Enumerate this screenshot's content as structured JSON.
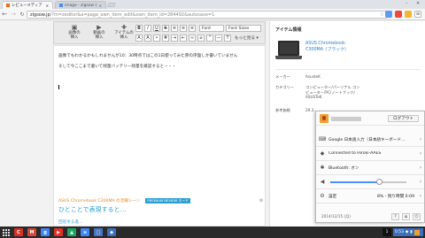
{
  "browser": {
    "tabs": [
      {
        "title": "レビューメディア「ジ…",
        "active": true
      },
      {
        "title": "image - zigsow (ジグ…",
        "active": false
      }
    ],
    "url_host": "zigsow.jp",
    "url_path": "/?m=zeditor&a=page_own_item_edit&own_item_id=284492&autosave=1"
  },
  "editor": {
    "insert_buttons": [
      {
        "label": "画像の\n挿入",
        "icon": "image-insert-icon"
      },
      {
        "label": "動画の\n挿入",
        "icon": "video-insert-icon"
      },
      {
        "label": "アイテムの\n挿入",
        "icon": "item-insert-icon"
      }
    ],
    "format": {
      "bold": "B",
      "italic": "I",
      "underline": "U",
      "strike": "S",
      "font": "Font",
      "font_sizes": "Font Sizes",
      "more": "もっと見る"
    },
    "paragraphs": [
      "画像でもわかるかもしれませんが10：30時点ではこの1日使ってみた際の序盤しか書いていません",
      "そして今ここまで書いて残量バッテリー残量を確認すると・・・"
    ],
    "footer": {
      "link": "ASUS Chromebook C300MA の活躍シーン",
      "badge": "PREMIUM REVIEW モード",
      "title": "ひとことで表現すると…",
      "subtitle": "回答する進..."
    }
  },
  "item_panel": {
    "heading": "アイテム情報",
    "product": "ASUS Chromebook\nC300MA（ブラック）",
    "specs": [
      {
        "label": "メーカー",
        "value": "AsusteK"
      },
      {
        "label": "カテゴリー",
        "value": "コンピューター/パーソナル コン\nピューター/PC/ノートブック/\nASUSTeK"
      },
      {
        "label": "参考価格",
        "value": "29,3…"
      }
    ]
  },
  "tray": {
    "logout": "ログアウト",
    "rows": [
      {
        "icon": "keyboard-icon",
        "label": "Google 日本語入力（日本語キーボード…"
      },
      {
        "icon": "wifi-icon",
        "label": "Connected to Hiroki-AAES"
      },
      {
        "icon": "bluetooth-icon",
        "label": "Bluetooth: オン"
      }
    ],
    "volume": 0.64,
    "settings_label": "設定",
    "battery": "8% - 残り時間 0:09",
    "date": "2014/12/15 (月)"
  },
  "shelf": {
    "apps": [
      {
        "name": "chrome-icon",
        "label": "C",
        "color": "#d93025"
      },
      {
        "name": "gmail-icon",
        "label": "M",
        "color": "#d44638"
      },
      {
        "name": "google-search-icon",
        "label": "g",
        "color": "#4285f4"
      },
      {
        "name": "youtube-icon",
        "label": "▶",
        "color": "#e52d27"
      },
      {
        "name": "drive-icon",
        "label": "▲",
        "color": "#1fa463"
      },
      {
        "name": "docs-icon",
        "label": "≡",
        "color": "#4285f4"
      },
      {
        "name": "files-icon",
        "label": "□",
        "color": "#4a75c4"
      },
      {
        "name": "store-icon",
        "label": "◆",
        "color": "#3d6fbf"
      }
    ],
    "page": "1",
    "clock": "0:53"
  },
  "colors": {
    "accent": "#2aa0d6",
    "link_orange": "#e1892c",
    "shelf": "#2a2a2a"
  }
}
